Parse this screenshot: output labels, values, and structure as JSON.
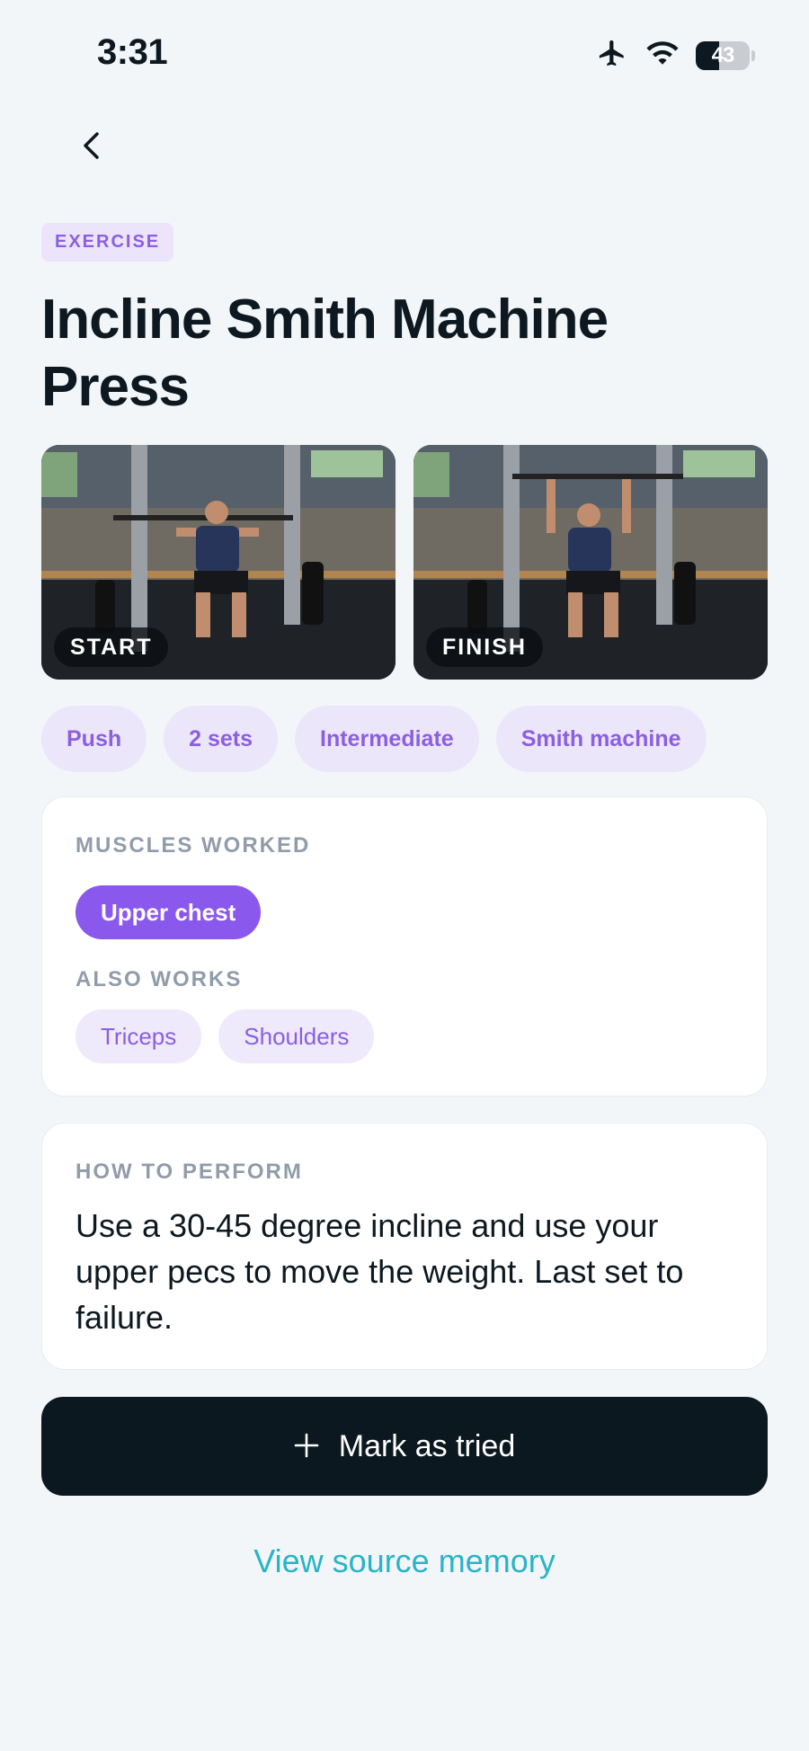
{
  "status_bar": {
    "time": "3:31",
    "battery_level": "43",
    "battery_fraction": 0.43,
    "icons": [
      "airplane-icon",
      "wifi-icon",
      "battery-icon"
    ]
  },
  "nav": {
    "back_icon": "chevron-left-icon"
  },
  "header": {
    "tag": "EXERCISE",
    "title": "Incline Smith Machine Press"
  },
  "photos": [
    {
      "label": "START"
    },
    {
      "label": "FINISH"
    }
  ],
  "chips": [
    "Push",
    "2 sets",
    "Intermediate",
    "Smith machine"
  ],
  "muscles": {
    "label": "MUSCLES WORKED",
    "primary": "Upper chest",
    "also_label": "ALSO WORKS",
    "secondary": [
      "Triceps",
      "Shoulders"
    ]
  },
  "how_to": {
    "label": "HOW TO PERFORM",
    "text": "Use a 30-45 degree incline and use your upper pecs to move the weight. Last set to failure."
  },
  "actions": {
    "mark_icon": "plus-icon",
    "mark_label": "Mark as tried",
    "source_link": "View source memory"
  },
  "colors": {
    "background": "#f3f6f8",
    "accent_purple": "#8a58ec",
    "chip_bg": "#ece6fb",
    "button_dark": "#0c1820",
    "link_teal": "#28b4c8"
  }
}
